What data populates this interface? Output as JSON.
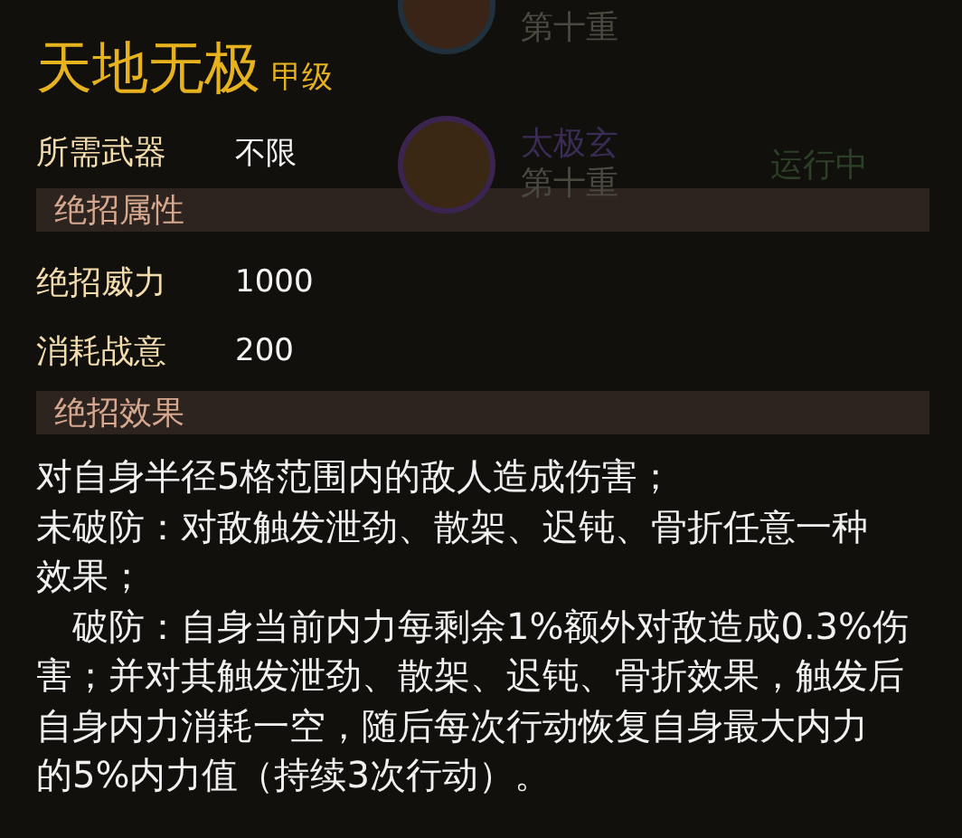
{
  "background": {
    "skills": [
      {
        "kind": "top",
        "level": "第十重"
      },
      {
        "kind": "full",
        "name": "太极玄",
        "level": "第十重",
        "status": "运行中"
      }
    ]
  },
  "tooltip": {
    "title": "天地无极",
    "grade": "甲级",
    "requirements": [
      {
        "label": "所需武器",
        "value": "不限"
      }
    ],
    "sections": [
      {
        "heading": "绝招属性",
        "stats": [
          {
            "label": "绝招威力",
            "value": "1000"
          },
          {
            "label": "消耗战意",
            "value": "200"
          }
        ]
      },
      {
        "heading": "绝招效果",
        "lines": [
          "对自身半径5格范围内的敌人造成伤害；",
          "未破防：对敌触发泄劲、散架、迟钝、骨折任意一种",
          "效果；",
          "　破防：自身当前内力每剩余1%额外对敌造成0.3%伤",
          "害；并对其触发泄劲、散架、迟钝、骨折效果，触发后",
          "自身内力消耗一空，随后每次行动恢复自身最大内力",
          "的5%内力值（持续3次行动）。"
        ]
      }
    ]
  }
}
